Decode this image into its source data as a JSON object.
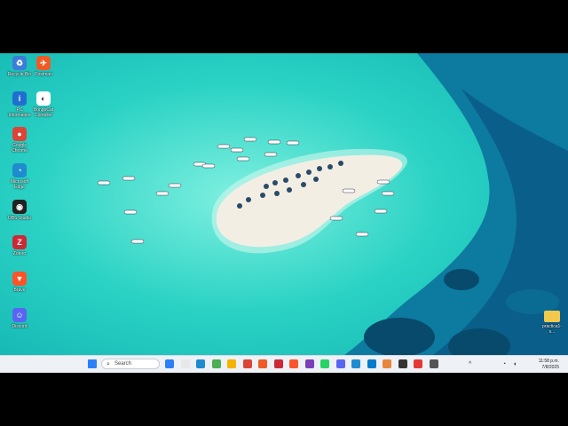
{
  "desktop_icons": [
    {
      "name": "recycle-bin",
      "label": "Recycle Bin",
      "color": "#3b7dd8",
      "glyph": "♻"
    },
    {
      "name": "postman",
      "label": "Postman",
      "color": "#ef5b25",
      "glyph": "✈"
    },
    {
      "name": "pc-info",
      "label": "PC Information",
      "color": "#1f6fd1",
      "glyph": "i"
    },
    {
      "name": "bongocat",
      "label": "BongoCat Compiler",
      "color": "#ffffff",
      "glyph": "◐"
    },
    {
      "name": "chrome",
      "label": "Google Chrome",
      "color": "#db4437",
      "glyph": "●"
    },
    {
      "name": "edge",
      "label": "Microsoft Edge",
      "color": "#1e8ccf",
      "glyph": "◔"
    },
    {
      "name": "obs",
      "label": "OBS Studio",
      "color": "#222222",
      "glyph": "◉"
    },
    {
      "name": "zotero",
      "label": "Zotero",
      "color": "#cc2936",
      "glyph": "Z"
    },
    {
      "name": "brave",
      "label": "Brave",
      "color": "#fb542b",
      "glyph": "▼"
    },
    {
      "name": "discord",
      "label": "Discord",
      "color": "#5865f2",
      "glyph": "☺"
    }
  ],
  "folder_icon": {
    "label": "practica1-s...",
    "color": "#f2c94c"
  },
  "taskbar": {
    "search_label": "Search",
    "clock_time": "11:58 p.m.",
    "clock_date": "7/8/2025",
    "pinned_colors": [
      "#2d7ff9",
      "#e8e8e8",
      "#1e8ccf",
      "#4caf50",
      "#f4b400",
      "#db4437",
      "#ef5b25",
      "#cc2936",
      "#fb542b",
      "#7b3fb9",
      "#25d366",
      "#5865f2",
      "#1e8ccf",
      "#007acc",
      "#e8863a",
      "#333333",
      "#e53935",
      "#555555"
    ]
  },
  "colors": {
    "lagoon": "#23d2c1",
    "deep_sea": "#0a5f8a",
    "sand": "#f3eee4"
  }
}
